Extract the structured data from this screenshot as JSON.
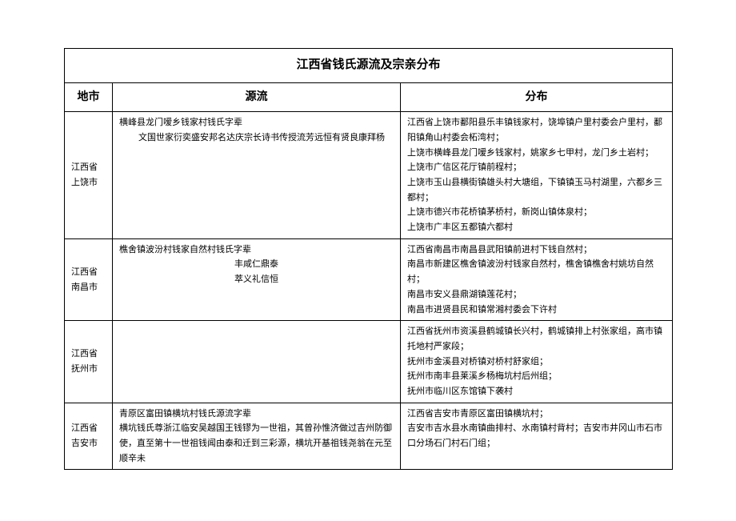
{
  "title": "江西省钱氏源流及宗亲分布",
  "headers": {
    "region": "地市",
    "source": "源流",
    "distribution": "分布"
  },
  "rows": [
    {
      "region": "江西省上饶市",
      "source_lines": [
        "横峰县龙门嗳乡钱家村钱氏字辈",
        "文国世家衍奕盛安邦名达庆宗长诗书传授流芳远恒有贤良康拜杨"
      ],
      "distribution": "江西省上饶市鄱阳县乐丰镇钱家村，饶埠镇户里村委会户里村，鄱阳镇角山村委会柘湾村；\n上饶市横峰县龙门嗳乡钱家村，姚家乡七甲村，龙门乡土岩村；\n上饶市广信区花厅镇前程村；\n上饶市玉山县横街镇雄头村大塘组，下镇镇玉马村湖里，六都乡三都村；\n上饶市德兴市花桥镇茅桥村，新岗山镇体泉村；\n上饶市广丰区五都镇六都村"
    },
    {
      "region": "江西省南昌市",
      "source_lines_center": [
        "樵舍镇波汾村钱家自然村钱氏字辈",
        "丰咸仁鼎泰",
        "萃义礼信恒"
      ],
      "distribution": "江西省南昌市南昌县武阳镇前进村下钱自然村；\n南昌市新建区樵舍镇波汾村钱家自然村，樵舍镇樵舍村姚坊自然村；\n南昌市安义县鼎湖镇莲花村；\n南昌市进贤县民和镇常湘村委会下许村"
    },
    {
      "region": "江西省抚州市",
      "source_lines": [],
      "distribution": "江西省抚州市资溪县鹤城镇长兴村，鹤城镇排上村张家组，高市镇托地村严家段；\n抚州市金溪县对桥镇对桥村舒家组；\n抚州市南丰县莱溪乡杨梅坑村后州组；\n抚州市临川区东馆镇下袭村"
    },
    {
      "region": "江西省吉安市",
      "source_lines": [
        "青原区富田镇横坑村钱氏源流字辈",
        "横坑钱氏尊浙江临安吴越国王钱镠为一世祖，其曾孙惟济做过吉州防御使，直至第十一世祖钱闻由泰和迁到三彩源，横坑开基祖钱尧翁在元至顺辛未"
      ],
      "distribution": "江西省吉安市青原区富田镇横坑村；\n吉安市吉水县水南镇曲排村、水南镇村背村；吉安市井冈山市石市口分场石门村石门组；"
    }
  ]
}
